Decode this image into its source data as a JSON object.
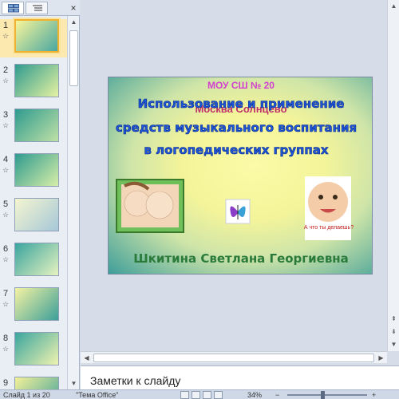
{
  "left_pane": {
    "tabs": [
      {
        "name": "slides-tab",
        "icon": "slides-icon"
      },
      {
        "name": "outline-tab",
        "icon": "outline-icon"
      }
    ],
    "close_glyph": "×",
    "star_glyph": "☆",
    "thumbnails": [
      {
        "number": "1",
        "selected": true
      },
      {
        "number": "2",
        "selected": false
      },
      {
        "number": "3",
        "selected": false
      },
      {
        "number": "4",
        "selected": false
      },
      {
        "number": "5",
        "selected": false
      },
      {
        "number": "6",
        "selected": false
      },
      {
        "number": "7",
        "selected": false
      },
      {
        "number": "8",
        "selected": false
      },
      {
        "number": "9",
        "selected": false
      }
    ]
  },
  "slide": {
    "school_line": "МОУ СШ № 20",
    "subtitle_line": "Mосква Солнцево",
    "title_line1": "Использование и применение",
    "title_line2": "средств музыкального воспитания",
    "title_line3": "в логопедических группах",
    "author": "Шкитина Светлана Георгиевна",
    "speech_bubble": "А что ты делаешь?"
  },
  "notes": {
    "placeholder": "Заметки к слайду"
  },
  "status": {
    "slide_text": "Слайд 1 из 20",
    "theme_text": "\"Тема Office\"",
    "zoom_text": "34%"
  },
  "colors": {
    "selected_thumb": "#f0b030",
    "wordart_blue": "#1f56d8",
    "author_green": "#2a7a3a",
    "school_magenta": "#d33fd0"
  }
}
